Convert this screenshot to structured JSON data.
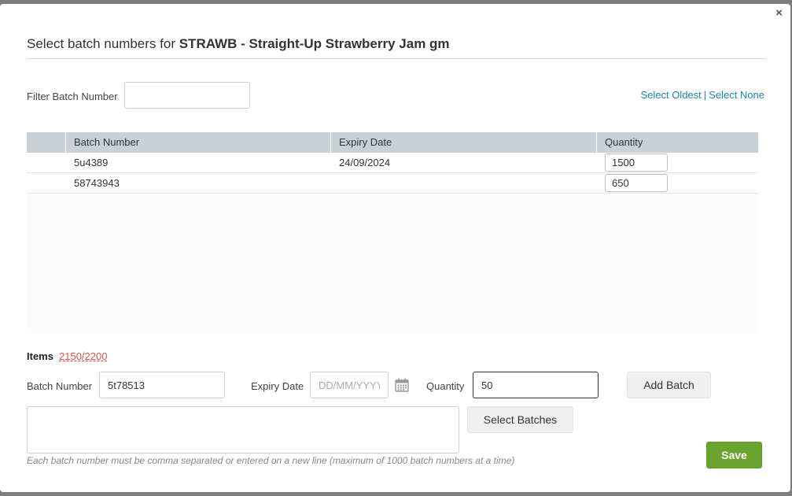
{
  "dialog": {
    "title_prefix": "Select batch numbers for ",
    "title_product": "STRAWB - Straight-Up Strawberry Jam gm",
    "close_glyph": "×"
  },
  "filter": {
    "label": "Filter Batch Number",
    "value": "",
    "placeholder": ""
  },
  "links": {
    "select_oldest": "Select Oldest",
    "separator": "|",
    "select_none": "Select None"
  },
  "table": {
    "columns": [
      "Batch Number",
      "Expiry Date",
      "Quantity"
    ],
    "rows": [
      {
        "batch": "5u4389",
        "expiry": "24/09/2024",
        "quantity": "1500"
      },
      {
        "batch": "58743943",
        "expiry": "",
        "quantity": "650"
      }
    ]
  },
  "items": {
    "label": "Items",
    "count": "2150/2200"
  },
  "add_form": {
    "batch_label": "Batch Number",
    "batch_value": "5t78513",
    "expiry_label": "Expiry Date",
    "expiry_value": "",
    "expiry_placeholder": "DD/MM/YYYY",
    "quantity_label": "Quantity",
    "quantity_value": "50",
    "add_button": "Add Batch",
    "select_batches_button": "Select Batches",
    "batch_list_value": "",
    "hint": "Each batch number must be comma separated or entered on a new line (maximum of 1000 batch numbers at a time)"
  },
  "save_button": "Save",
  "icons": {
    "close": "close-icon",
    "calendar": "calendar-icon"
  },
  "colors": {
    "link": "#1a8aa8",
    "save": "#6aa42e",
    "items_count": "#d9534f",
    "table_header": "#c8d1d8"
  }
}
